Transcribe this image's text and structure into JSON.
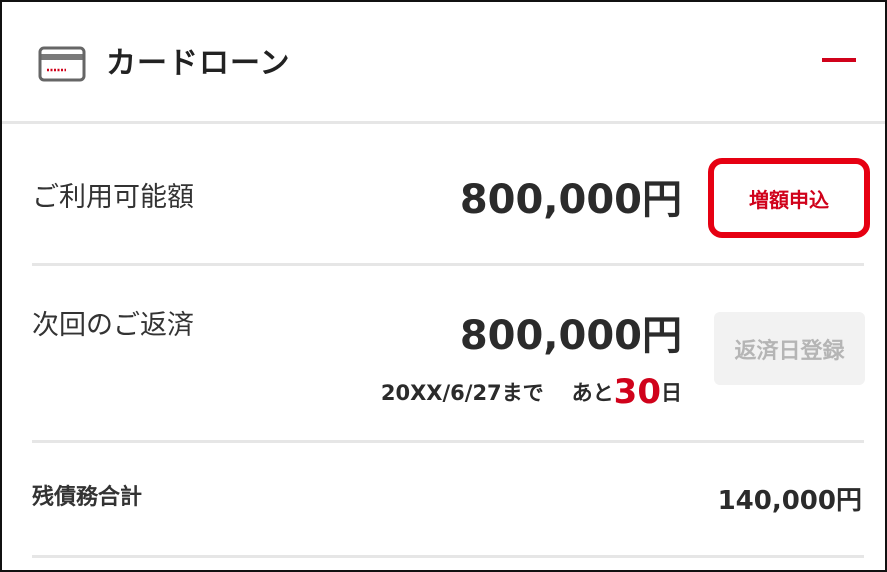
{
  "header": {
    "title": "カードローン",
    "icon": "credit-card-icon",
    "collapse_icon": "minus-icon",
    "accent": "#d0021b"
  },
  "available": {
    "label": "ご利用可能額",
    "amount": "800,000円",
    "button_label": "増額申込",
    "button_border": "#e60012"
  },
  "next_payment": {
    "label": "次回のご返済",
    "amount": "800,000円",
    "due_date": "20XX/6/27まで",
    "remaining_prefix": "あと",
    "remaining_days": "30",
    "remaining_suffix": "日",
    "button_label": "返済日登録"
  },
  "balance": {
    "label": "残債務合計",
    "amount": "140,000円"
  }
}
